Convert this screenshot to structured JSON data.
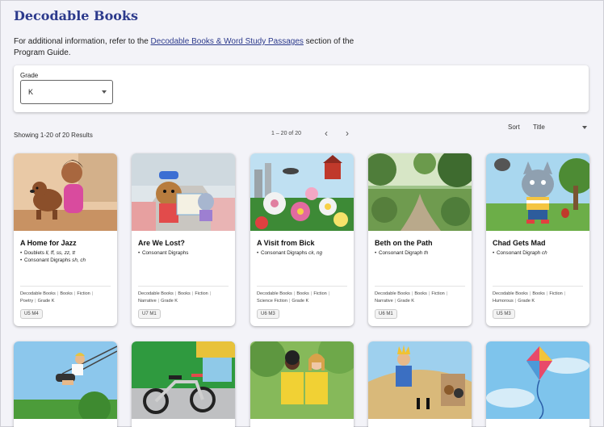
{
  "page": {
    "title": "Decodable Books",
    "intro_prefix": "For additional information, refer to the ",
    "intro_link": "Decodable Books & Word Study Passages",
    "intro_suffix": " section of the Program Guide."
  },
  "filter": {
    "grade_label": "Grade",
    "grade_value": "K"
  },
  "results": {
    "count_text": "Showing 1-20 of 20 Results",
    "pager_text": "1 – 20 of 20",
    "prev_icon": "chevron-left-icon",
    "next_icon": "chevron-right-icon",
    "sort_label": "Sort",
    "sort_value": "Title"
  },
  "cards": [
    {
      "title": "A Home for Jazz",
      "skills": [
        {
          "text": "Doublets ",
          "italic": "ll, ff, ss, zz, tt"
        },
        {
          "text": "Consonant Digraphs ",
          "italic": "sh, ch"
        }
      ],
      "tags": [
        "Decodable Books",
        "Books",
        "Fiction",
        "Poetry",
        "Grade K"
      ],
      "badge": "U5 M4"
    },
    {
      "title": "Are We Lost?",
      "skills": [
        {
          "text": "Consonant Digraphs",
          "italic": ""
        }
      ],
      "tags": [
        "Decodable Books",
        "Books",
        "Fiction",
        "Narrative",
        "Grade K"
      ],
      "badge": "U7 M1"
    },
    {
      "title": "A Visit from Bick",
      "skills": [
        {
          "text": "Consonant Digraphs ",
          "italic": "ck, ng"
        }
      ],
      "tags": [
        "Decodable Books",
        "Books",
        "Fiction",
        "Science Fiction",
        "Grade K"
      ],
      "badge": "U6 M3"
    },
    {
      "title": "Beth on the Path",
      "skills": [
        {
          "text": "Consonant Digraph ",
          "italic": "th"
        }
      ],
      "tags": [
        "Decodable Books",
        "Books",
        "Fiction",
        "Narrative",
        "Grade K"
      ],
      "badge": "U6 M1"
    },
    {
      "title": "Chad Gets Mad",
      "skills": [
        {
          "text": "Consonant Digraph ",
          "italic": "ch"
        }
      ],
      "tags": [
        "Decodable Books",
        "Books",
        "Fiction",
        "Humorous",
        "Grade K"
      ],
      "badge": "U5 M3"
    }
  ],
  "colors": {
    "title_blue": "#2c3a8c",
    "page_bg": "#f3f3f8"
  }
}
